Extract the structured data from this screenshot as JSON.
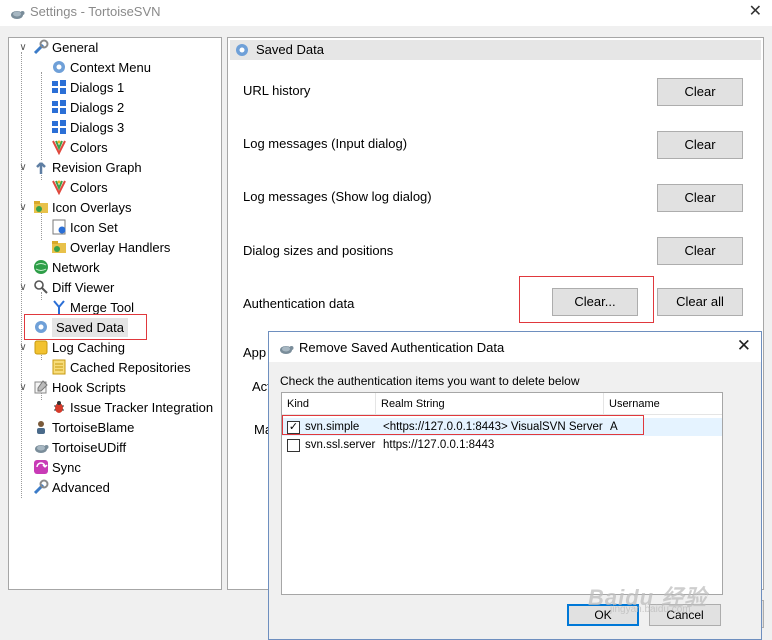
{
  "window": {
    "title": "Settings - TortoiseSVN",
    "close_glyph": "✕"
  },
  "tree": {
    "items": [
      {
        "label": "General",
        "icon": "general-icon"
      },
      {
        "label": "Context Menu",
        "icon": "gear-icon"
      },
      {
        "label": "Dialogs 1",
        "icon": "dialogs-icon"
      },
      {
        "label": "Dialogs 2",
        "icon": "dialogs-icon"
      },
      {
        "label": "Dialogs 3",
        "icon": "dialogs-icon"
      },
      {
        "label": "Colors",
        "icon": "colors-icon"
      },
      {
        "label": "Revision Graph",
        "icon": "revision-graph-icon"
      },
      {
        "label": "Colors",
        "icon": "colors-icon"
      },
      {
        "label": "Icon Overlays",
        "icon": "icon-overlays-icon"
      },
      {
        "label": "Icon Set",
        "icon": "icon-set-icon"
      },
      {
        "label": "Overlay Handlers",
        "icon": "overlay-handlers-icon"
      },
      {
        "label": "Network",
        "icon": "network-icon"
      },
      {
        "label": "Diff Viewer",
        "icon": "diff-viewer-icon"
      },
      {
        "label": "Merge Tool",
        "icon": "merge-tool-icon"
      },
      {
        "label": "Saved Data",
        "icon": "gear-icon"
      },
      {
        "label": "Log Caching",
        "icon": "log-caching-icon"
      },
      {
        "label": "Cached Repositories",
        "icon": "cached-repositories-icon"
      },
      {
        "label": "Hook Scripts",
        "icon": "hook-scripts-icon"
      },
      {
        "label": "Issue Tracker Integration",
        "icon": "bug-icon"
      },
      {
        "label": "TortoiseBlame",
        "icon": "tortoiseblame-icon"
      },
      {
        "label": "TortoiseUDiff",
        "icon": "tortoiseudiff-icon"
      },
      {
        "label": "Sync",
        "icon": "sync-icon"
      },
      {
        "label": "Advanced",
        "icon": "advanced-icon"
      }
    ]
  },
  "panel": {
    "title": "Saved Data",
    "rows": [
      {
        "label": "URL history",
        "button": "Clear"
      },
      {
        "label": "Log messages (Input dialog)",
        "button": "Clear"
      },
      {
        "label": "Log messages (Show log dialog)",
        "button": "Clear"
      },
      {
        "label": "Dialog sizes and positions",
        "button": "Clear"
      },
      {
        "label": "Authentication data",
        "button": "Clear...",
        "button2": "Clear all"
      }
    ],
    "partial_label_1": "App",
    "partial_label_2": "Act",
    "partial_label_3": "Ma"
  },
  "dialog": {
    "title": "Remove Saved Authentication Data",
    "instruction": "Check the authentication items you want to delete below",
    "columns": [
      "Kind",
      "Realm String",
      "Username"
    ],
    "rows": [
      {
        "checked": true,
        "kind": "svn.simple",
        "realm": "<https://127.0.0.1:8443> VisualSVN Server",
        "username": "A"
      },
      {
        "checked": false,
        "kind": "svn.ssl.server",
        "realm": "https://127.0.0.1:8443",
        "username": ""
      }
    ],
    "ok_label": "OK",
    "cancel_label": "Cancel"
  },
  "watermark": {
    "text": "Baidu 经验",
    "sub": "jingyan.baidu.com"
  },
  "colors": {
    "highlight_red": "#e0383d",
    "accent_blue": "#0078d7"
  }
}
